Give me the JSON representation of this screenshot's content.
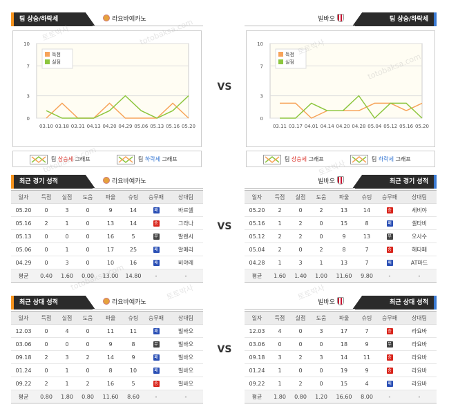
{
  "vs_label": "VS",
  "watermark": [
    "토토박사",
    "totobaksa.com"
  ],
  "trend": {
    "title": "팀 상승/하락세",
    "legend": {
      "up_prefix": "팀 ",
      "up_word": "상승세",
      "up_suffix": " 그래프",
      "down_prefix": "팀 ",
      "down_word": "하락세",
      "down_suffix": " 그래프"
    },
    "series_labels": [
      "득점",
      "실점"
    ],
    "colors": {
      "scored": "#f7a45a",
      "conceded": "#8dc63f",
      "grid": "#dddddd"
    }
  },
  "teams": {
    "left": {
      "name": "라요바예카노"
    },
    "right": {
      "name": "빌바오"
    }
  },
  "chart_data": [
    {
      "type": "line",
      "title": "",
      "x": [
        "03.10",
        "03.18",
        "03.31",
        "04.13",
        "04.20",
        "04.29",
        "05.06",
        "05.13",
        "05.16",
        "05.20"
      ],
      "ylim": [
        0,
        10
      ],
      "yticks": [
        0,
        3,
        7,
        10
      ],
      "grid": true,
      "legend_placement": "top-left",
      "series": [
        {
          "name": "득점",
          "values": [
            0,
            2,
            0,
            0,
            2,
            0,
            0,
            0,
            2,
            0
          ]
        },
        {
          "name": "실점",
          "values": [
            1,
            0,
            0,
            0,
            1,
            3,
            1,
            0,
            1,
            3
          ]
        }
      ]
    },
    {
      "type": "line",
      "title": "",
      "x": [
        "03.11",
        "03.17",
        "04.01",
        "04.14",
        "04.20",
        "04.28",
        "05.04",
        "05.12",
        "05.16",
        "05.20"
      ],
      "ylim": [
        0,
        10
      ],
      "yticks": [
        0,
        3,
        7,
        10
      ],
      "grid": true,
      "legend_placement": "top-left",
      "series": [
        {
          "name": "득점",
          "values": [
            2,
            2,
            0,
            1,
            1,
            1,
            2,
            2,
            1,
            2
          ]
        },
        {
          "name": "실점",
          "values": [
            0,
            0,
            2,
            1,
            1,
            3,
            0,
            2,
            2,
            0
          ]
        }
      ]
    }
  ],
  "headers": [
    "일자",
    "득점",
    "실점",
    "도움",
    "파울",
    "슈팅",
    "승무패",
    "상대팀"
  ],
  "result_glyph": {
    "win": "승",
    "draw": "무",
    "loss": "패"
  },
  "recent": {
    "title": "최근 경기 성적",
    "left": {
      "rows": [
        [
          "05.20",
          "0",
          "3",
          "0",
          "9",
          "14",
          "loss",
          "바르셀"
        ],
        [
          "05.16",
          "2",
          "1",
          "0",
          "13",
          "14",
          "win",
          "그라나"
        ],
        [
          "05.13",
          "0",
          "0",
          "0",
          "16",
          "5",
          "draw",
          "발렌시"
        ],
        [
          "05.06",
          "0",
          "1",
          "0",
          "17",
          "25",
          "loss",
          "알메리"
        ],
        [
          "04.29",
          "0",
          "3",
          "0",
          "10",
          "16",
          "loss",
          "비야레"
        ]
      ],
      "avg": [
        "평균",
        "0.40",
        "1.60",
        "0.00",
        "13.00",
        "14.80",
        "-",
        "-"
      ]
    },
    "right": {
      "rows": [
        [
          "05.20",
          "2",
          "0",
          "2",
          "13",
          "14",
          "win",
          "세비야"
        ],
        [
          "05.16",
          "1",
          "2",
          "0",
          "15",
          "8",
          "loss",
          "셀타비"
        ],
        [
          "05.12",
          "2",
          "2",
          "0",
          "9",
          "13",
          "draw",
          "오사수"
        ],
        [
          "05.04",
          "2",
          "0",
          "2",
          "8",
          "7",
          "win",
          "헤타페"
        ],
        [
          "04.28",
          "1",
          "3",
          "1",
          "13",
          "7",
          "loss",
          "AT마드"
        ]
      ],
      "avg": [
        "평균",
        "1.60",
        "1.40",
        "1.00",
        "11.60",
        "9.80",
        "-",
        "-"
      ]
    }
  },
  "h2h": {
    "title": "최근 상대 성적",
    "left": {
      "rows": [
        [
          "12.03",
          "0",
          "4",
          "0",
          "11",
          "11",
          "loss",
          "빌바오"
        ],
        [
          "03.06",
          "0",
          "0",
          "0",
          "9",
          "8",
          "draw",
          "빌바오"
        ],
        [
          "09.18",
          "2",
          "3",
          "2",
          "14",
          "9",
          "loss",
          "빌바오"
        ],
        [
          "01.24",
          "0",
          "1",
          "0",
          "8",
          "10",
          "loss",
          "빌바오"
        ],
        [
          "09.22",
          "2",
          "1",
          "2",
          "16",
          "5",
          "win",
          "빌바오"
        ]
      ],
      "avg": [
        "평균",
        "0.80",
        "1.80",
        "0.80",
        "11.60",
        "8.60",
        "-",
        "-"
      ]
    },
    "right": {
      "rows": [
        [
          "12.03",
          "4",
          "0",
          "3",
          "17",
          "7",
          "win",
          "라요바"
        ],
        [
          "03.06",
          "0",
          "0",
          "0",
          "18",
          "9",
          "draw",
          "라요바"
        ],
        [
          "09.18",
          "3",
          "2",
          "3",
          "14",
          "11",
          "win",
          "라요바"
        ],
        [
          "01.24",
          "1",
          "0",
          "0",
          "19",
          "9",
          "win",
          "라요바"
        ],
        [
          "09.22",
          "1",
          "2",
          "0",
          "15",
          "4",
          "loss",
          "라요바"
        ]
      ],
      "avg": [
        "평균",
        "1.80",
        "0.80",
        "1.20",
        "16.60",
        "8.00",
        "-",
        "-"
      ]
    }
  }
}
